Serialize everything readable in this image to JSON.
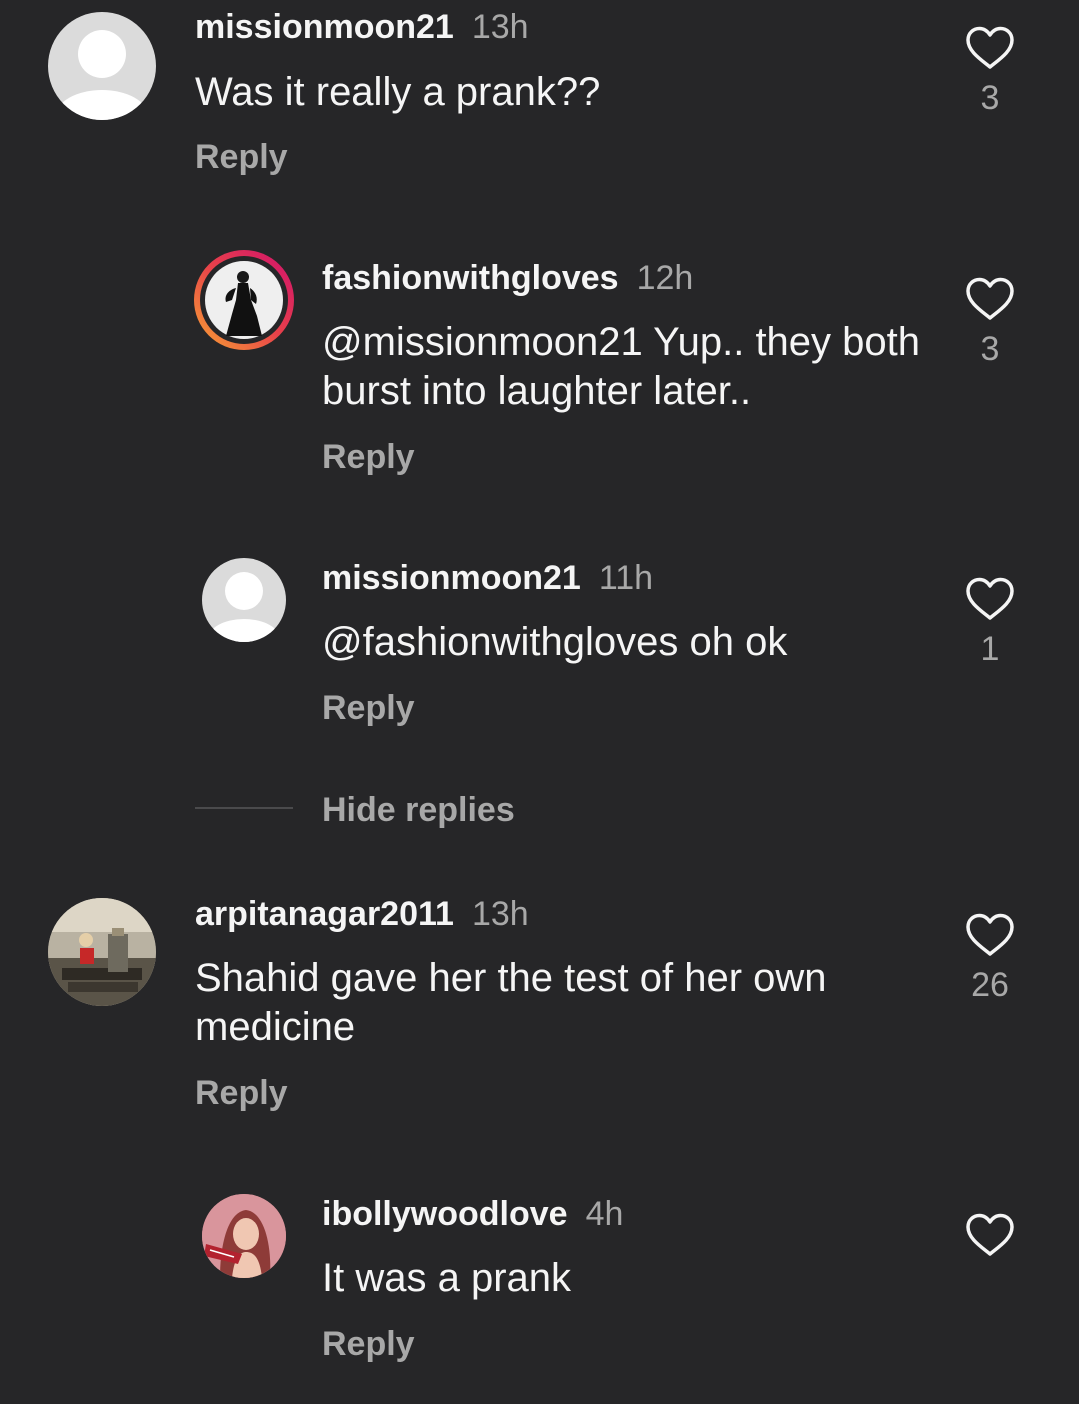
{
  "comments": [
    {
      "username": "missionmoon21",
      "time": "13h",
      "text": "Was it really a prank??",
      "reply_label": "Reply",
      "likes": "3"
    },
    {
      "username": "fashionwithgloves",
      "time": "12h",
      "text": "@missionmoon21 Yup.. they both burst into laughter later..",
      "reply_label": "Reply",
      "likes": "3"
    },
    {
      "username": "missionmoon21",
      "time": "11h",
      "text": "@fashionwithgloves oh ok",
      "reply_label": "Reply",
      "likes": "1"
    },
    {
      "username": "arpitanagar2011",
      "time": "13h",
      "text": "Shahid gave her the test of her own medicine",
      "reply_label": "Reply",
      "likes": "26"
    },
    {
      "username": "ibollywoodlove",
      "time": "4h",
      "text": "It was a prank",
      "reply_label": "Reply",
      "likes": ""
    }
  ],
  "hide_replies_label": "Hide replies",
  "icons": {
    "like": "heart-outline-icon",
    "default_avatar": "person-silhouette-icon"
  },
  "colors": {
    "background": "#262628",
    "primary_text": "#f5f5f5",
    "secondary_text": "#a8a8a8",
    "story_ring_start": "#f9a533",
    "story_ring_end": "#d0106e"
  }
}
